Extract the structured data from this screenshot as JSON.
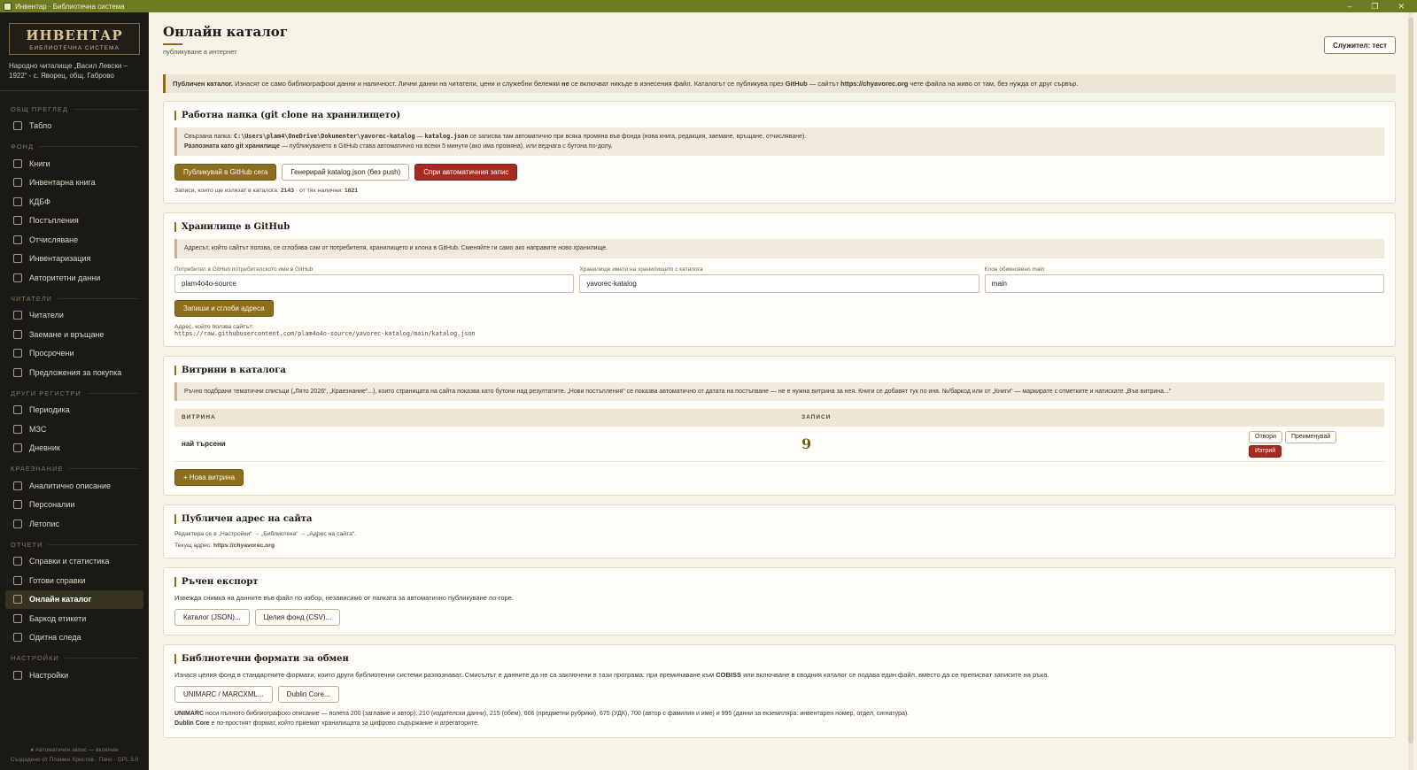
{
  "window": {
    "title": "Инвентар · Библиотечна система",
    "min": "–",
    "max": "❐",
    "close": "✕"
  },
  "brand": {
    "title": "ИНВЕНТАР",
    "subtitle": "БИБЛИОТЕЧНА СИСТЕМА",
    "org": "Народно читалище „Васил Левски – 1922“ - с. Яворец, общ. Габрово"
  },
  "sidebar": {
    "sections": [
      {
        "title": "ОБЩ ПРЕГЛЕД",
        "items": [
          {
            "label": "Табло",
            "icon": "dashboard-icon"
          }
        ]
      },
      {
        "title": "ФОНД",
        "items": [
          {
            "label": "Книги",
            "icon": "book-icon"
          },
          {
            "label": "Инвентарна книга",
            "icon": "open-book-icon"
          },
          {
            "label": "КДБФ",
            "icon": "ledger-icon"
          },
          {
            "label": "Постъпления",
            "icon": "inbox-icon"
          },
          {
            "label": "Отчисляване",
            "icon": "outbox-icon"
          },
          {
            "label": "Инвентаризация",
            "icon": "checklist-icon"
          },
          {
            "label": "Авторитетни данни",
            "icon": "layers-icon"
          }
        ]
      },
      {
        "title": "ЧИТАТЕЛИ",
        "items": [
          {
            "label": "Читатели",
            "icon": "users-icon"
          },
          {
            "label": "Заемане и връщане",
            "icon": "refresh-icon"
          },
          {
            "label": "Просрочени",
            "icon": "clock-icon"
          },
          {
            "label": "Предложения за покупка",
            "icon": "lightbulb-icon"
          }
        ]
      },
      {
        "title": "ДРУГИ РЕГИСТРИ",
        "items": [
          {
            "label": "Периодика",
            "icon": "newspaper-icon"
          },
          {
            "label": "МЗС",
            "icon": "exchange-icon"
          },
          {
            "label": "Дневник",
            "icon": "calendar-icon"
          }
        ]
      },
      {
        "title": "КРАЕЗНАНИЕ",
        "items": [
          {
            "label": "Аналитично описание",
            "icon": "document-icon"
          },
          {
            "label": "Персоналии",
            "icon": "person-icon"
          },
          {
            "label": "Летопис",
            "icon": "hourglass-icon"
          }
        ]
      },
      {
        "title": "ОТЧЕТИ",
        "items": [
          {
            "label": "Справки и статистика",
            "icon": "chart-icon"
          },
          {
            "label": "Готови справки",
            "icon": "report-icon"
          },
          {
            "label": "Онлайн каталог",
            "icon": "globe-icon",
            "active": true
          },
          {
            "label": "Баркод етикети",
            "icon": "tag-icon"
          },
          {
            "label": "Одитна следа",
            "icon": "magnifier-icon"
          }
        ]
      },
      {
        "title": "НАСТРОЙКИ",
        "items": [
          {
            "label": "Настройки",
            "icon": "sliders-icon"
          }
        ]
      }
    ],
    "footer_line1": "● Автоматичен запис — включен",
    "footer_line2": "Създадено от Пламен Христов · Пачо · GPL 3.0"
  },
  "header": {
    "title": "Онлайн каталог",
    "subtitle": "публикуване в интернет",
    "user_button": "Служител: тест"
  },
  "notice": {
    "b1": "Публичен каталог.",
    "t1": " Изнасят се само библиографски данни и наличност. Лични данни на читатели, цени и служебни бележки ",
    "b2": "не",
    "t2": " се включват никъде в изнесения файл. Каталогът се публикува през ",
    "b3": "GitHub",
    "t3": " — сайтът ",
    "b4": "https://chyavorec.org",
    "t4": " чете файла на живо от там, без нужда от друг сървър."
  },
  "work_folder": {
    "title": "Работна папка (git clone на хранилището)",
    "line1_pre": "Свързана папка: ",
    "path": "C:\\Users\\plam4\\OneDrive\\Dokumenter\\yavorec-katalog",
    "line1_mid": " — ",
    "file": "katalog.json",
    "line1_post": " се записва там автоматично при всяка промяна във фонда (нова книга, редакция, заемане, връщане, отчисляване).",
    "line2_bold": "Разпозната като git хранилище",
    "line2_rest": " — публикуването в GitHub става автоматично на всеки 5 минути (ако има промяна), или веднага с бутона по-долу.",
    "btn_publish": "Публикувай в GitHub сега",
    "btn_generate": "Генерирай katalog.json (без push)",
    "btn_stop": "Спри автоматичния запис",
    "stats_pre": "Записи, които ще излязат в каталога: ",
    "stats_total": "2143",
    "stats_mid": " · от тях налични: ",
    "stats_avail": "1821"
  },
  "github": {
    "title": "Хранилище в GitHub",
    "info": "Адресът, който сайтът ползва, се сглобява сам от потребителя, хранилището и клона в GitHub. Сменяйте ги само ако направите ново хранилище.",
    "user_label": "Потребител в GitHub потребителското име в GitHub",
    "user_value": "plam4o4o-source",
    "repo_label": "Хранилище името на хранилището с каталога",
    "repo_value": "yavorec-katalog",
    "branch_label": "Клон обикновено main",
    "branch_value": "main",
    "save_btn": "Запиши и сглоби адреса",
    "address_label": "Адрес, който ползва сайтът:",
    "address_value": "https://raw.githubusercontent.com/plam4o4o-source/yavorec-katalog/main/katalog.json"
  },
  "showcases": {
    "title": "Витрини в каталога",
    "info": "Ръчно подбрани тематични списъци („Лято 2026“, „Краезнание“...), които страницата на сайта показва като бутони над резултатите. „Нови постъпления“ се показва автоматично от датата на постъпване — не е нужна витрина за нея. Книги се добавят тук по инв. №/баркод или от „Книги“ — маркирате с отметките и натискате „Във витрина...“",
    "col_name": "ВИТРИНА",
    "col_count": "ЗАПИСИ",
    "rows": [
      {
        "name": "най търсени",
        "count": "9"
      }
    ],
    "btn_open": "Отвори",
    "btn_rename": "Преименувай",
    "btn_delete": "Изтрий",
    "btn_new": "+ Нова витрина"
  },
  "public_address": {
    "title": "Публичен адрес на сайта",
    "edit_note": "Редактира се в „Настройки“ → „Библиотека“ → „Адрес на сайта“.",
    "current_pre": "Текущ адрес: ",
    "current_value": "https://chyavorec.org"
  },
  "manual_export": {
    "title": "Ръчен експорт",
    "desc": "Извежда снимка на данните във файл по избор, независимо от папката за автоматично публикуване по-горе.",
    "btn_json": "Каталог (JSON)...",
    "btn_csv": "Целия фонд (CSV)..."
  },
  "formats": {
    "title": "Библиотечни формати за обмен",
    "desc_pre": "Изнася целия фонд в стандартните формати, които други библиотечни системи разпознават. Смисълът е данните да не са заключени в тази програма: при преминаване към ",
    "desc_bold": "COBISS",
    "desc_post": " или включване в сводния каталог се подава един файл, вместо да се преписват записите на ръка.",
    "btn_unimarc": "UNIMARC / MARCXML...",
    "btn_dublin": "Dublin Core...",
    "note1_bold": "UNIMARC",
    "note1_rest": " носи пълното библиографско описание — полета 200 (заглавие и автор), 210 (издателски данни), 215 (обем), 606 (предметни рубрики), 675 (УДК), 700 (автор с фамилия и име) и 995 (данни за екземпляра: инвентарен номер, отдел, сигнатура).",
    "note2_bold": "Dublin Core",
    "note2_rest": " е по-простият формат, който приемат хранилищата за цифрово съдържание и агрегаторите."
  }
}
